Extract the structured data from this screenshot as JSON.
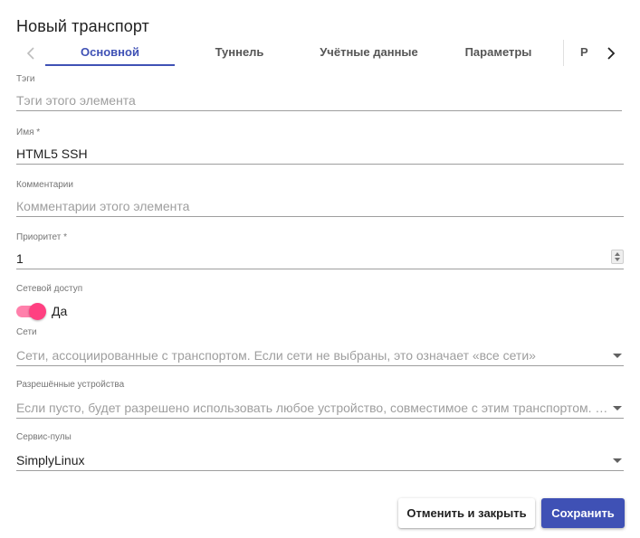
{
  "dialog": {
    "title": "Новый транспорт"
  },
  "tabs": {
    "items": [
      {
        "label": "Основной",
        "active": true
      },
      {
        "label": "Туннель",
        "active": false
      },
      {
        "label": "Учётные данные",
        "active": false
      },
      {
        "label": "Параметры",
        "active": false
      }
    ],
    "partial_label": "Р",
    "prev_icon": "chevron-left-icon",
    "next_icon": "chevron-right-icon"
  },
  "fields": {
    "tags": {
      "label": "Тэги",
      "placeholder": "Тэги этого элемента",
      "value": ""
    },
    "name": {
      "label": "Имя *",
      "value": "HTML5 SSH"
    },
    "comments": {
      "label": "Комментарии",
      "placeholder": "Комментарии этого элемента",
      "value": ""
    },
    "priority": {
      "label": "Приоритет *",
      "value": "1"
    },
    "net_access": {
      "label": "Сетевой доступ",
      "toggle_label": "Да",
      "enabled": true
    },
    "networks": {
      "label": "Сети",
      "placeholder": "Сети, ассоциированные с транспортом. Если сети не выбраны, это означает «все сети»"
    },
    "allowed_devices": {
      "label": "Разрешённые устройства",
      "placeholder": "Если пусто, будет разрешено использовать любое устройство, совместимое с этим транспортом. …"
    },
    "service_pools": {
      "label": "Сервис-пулы",
      "value": "SimplyLinux"
    }
  },
  "actions": {
    "cancel_label": "Отменить и закрыть",
    "save_label": "Сохранить"
  },
  "colors": {
    "primary": "#3f51b5",
    "accent": "#ff4081"
  }
}
